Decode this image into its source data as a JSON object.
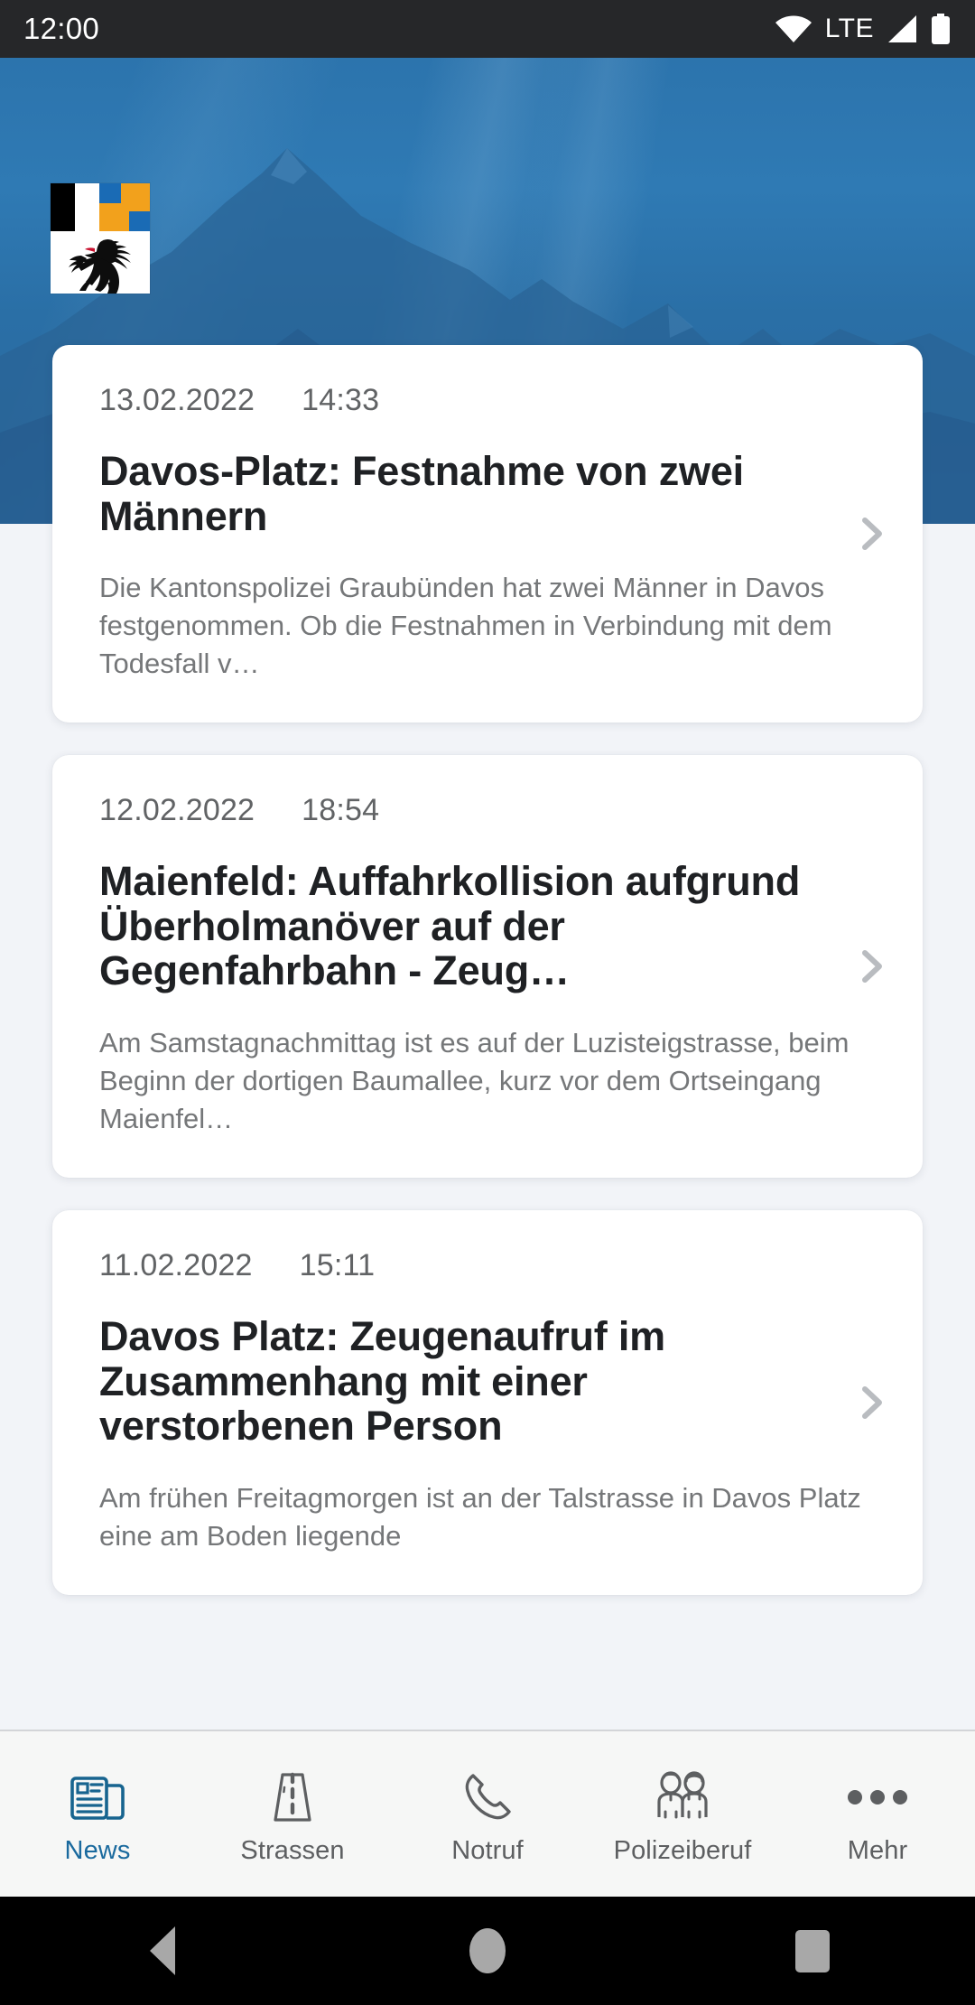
{
  "status_bar": {
    "clock": "12:00",
    "network_label": "LTE",
    "icons": [
      "wifi-icon",
      "signal-icon",
      "battery-icon"
    ]
  },
  "hero": {
    "logo_alt": "graubuenden-coat-of-arms"
  },
  "news": {
    "items": [
      {
        "date": "13.02.2022",
        "time": "14:33",
        "title": "Davos-Platz: Festnahme von zwei Männern",
        "body": "Die Kantonspolizei Graubünden hat zwei Männer in Davos festgenommen. Ob die Festnahmen in Verbindung mit dem Todesfall v…"
      },
      {
        "date": "12.02.2022",
        "time": "18:54",
        "title": "Maienfeld: Auffahrkollision aufgrund Überholmanöver auf der Gegenfahrbahn - Zeug…",
        "body": "Am Samstagnachmittag ist es auf der Luzisteigstrasse, beim Beginn der dortigen Baumallee, kurz vor dem Ortseingang Maienfel…"
      },
      {
        "date": "11.02.2022",
        "time": "15:11",
        "title": "Davos Platz: Zeugenaufruf im Zusammenhang mit einer verstorbenen Person",
        "body": "Am frühen Freitagmorgen ist an der Talstrasse in Davos Platz eine am Boden liegende"
      }
    ]
  },
  "bottom_nav": {
    "items": [
      {
        "label": "News",
        "icon": "newspaper-icon",
        "active": true
      },
      {
        "label": "Strassen",
        "icon": "road-icon",
        "active": false
      },
      {
        "label": "Notruf",
        "icon": "phone-icon",
        "active": false
      },
      {
        "label": "Polizeiberuf",
        "icon": "people-icon",
        "active": false
      },
      {
        "label": "Mehr",
        "icon": "more-dots-icon",
        "active": false
      }
    ]
  },
  "system_nav": {
    "back": "back-button",
    "home": "home-button",
    "recents": "recents-button"
  },
  "colors": {
    "accent": "#1a6a9e",
    "hero_blue": "#2a6ea3",
    "card_bg": "#ffffff",
    "page_bg": "#f2f4f8",
    "title_text": "#1f2124",
    "body_text": "#757779",
    "meta_text": "#616365"
  }
}
